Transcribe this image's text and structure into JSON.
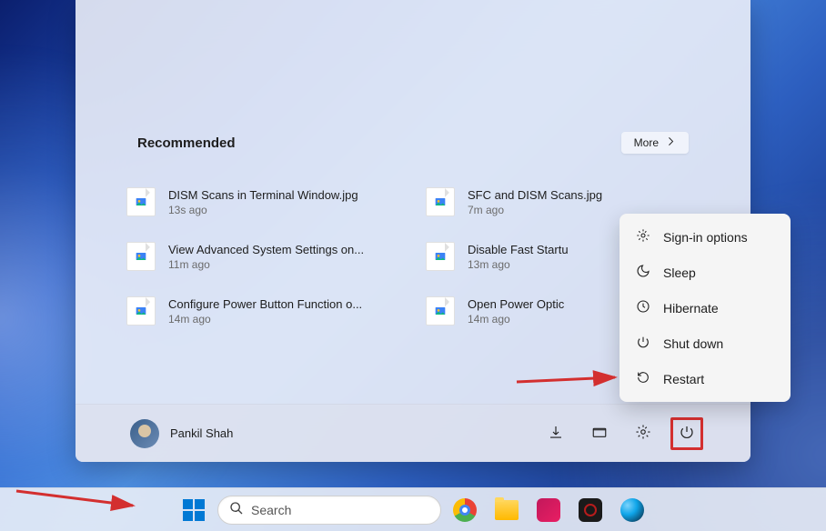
{
  "recommended": {
    "title": "Recommended",
    "more_label": "More",
    "items": [
      {
        "name": "DISM Scans in Terminal Window.jpg",
        "time": "13s ago"
      },
      {
        "name": "SFC and DISM Scans.jpg",
        "time": "7m ago"
      },
      {
        "name": "View Advanced System Settings on...",
        "time": "11m ago"
      },
      {
        "name": "Disable Fast Startu",
        "time": "13m ago"
      },
      {
        "name": "Configure Power Button Function o...",
        "time": "14m ago"
      },
      {
        "name": "Open Power Optic",
        "time": "14m ago"
      }
    ]
  },
  "user": {
    "name": "Pankil Shah"
  },
  "power_menu": [
    {
      "label": "Sign-in options",
      "icon": "gear"
    },
    {
      "label": "Sleep",
      "icon": "moon"
    },
    {
      "label": "Hibernate",
      "icon": "clock"
    },
    {
      "label": "Shut down",
      "icon": "power"
    },
    {
      "label": "Restart",
      "icon": "restart"
    }
  ],
  "search": {
    "placeholder": "Search"
  }
}
